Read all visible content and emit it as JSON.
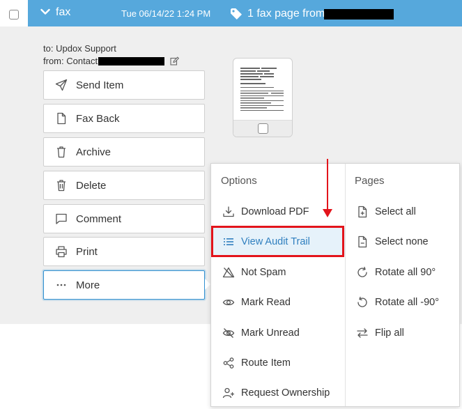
{
  "header": {
    "type_label": "fax",
    "date": "Tue 06/14/22 1:24 PM",
    "subject": "1 fax page from",
    "bar_color": "#56a8dc"
  },
  "meta": {
    "to_label": "to:",
    "to_value": "Updox Support",
    "from_label": "from:",
    "from_value": "Contact"
  },
  "actions": [
    {
      "label": "Send Item",
      "icon": "send-icon"
    },
    {
      "label": "Fax Back",
      "icon": "file-icon"
    },
    {
      "label": "Archive",
      "icon": "archive-icon"
    },
    {
      "label": "Delete",
      "icon": "trash-icon"
    },
    {
      "label": "Comment",
      "icon": "comment-icon"
    },
    {
      "label": "Print",
      "icon": "printer-icon"
    },
    {
      "label": "More",
      "icon": "ellipsis-icon"
    }
  ],
  "menu": {
    "options_heading": "Options",
    "pages_heading": "Pages",
    "options": [
      {
        "label": "Download PDF",
        "icon": "download-icon"
      },
      {
        "label": "View Audit Trail",
        "icon": "list-icon"
      },
      {
        "label": "Not Spam",
        "icon": "no-spam-icon"
      },
      {
        "label": "Mark Read",
        "icon": "eye-icon"
      },
      {
        "label": "Mark Unread",
        "icon": "eye-off-icon"
      },
      {
        "label": "Route Item",
        "icon": "share-icon"
      },
      {
        "label": "Request Ownership",
        "icon": "user-add-icon"
      }
    ],
    "pages": [
      {
        "label": "Select all",
        "icon": "file-plus-icon"
      },
      {
        "label": "Select none",
        "icon": "file-minus-icon"
      },
      {
        "label": "Rotate all 90°",
        "icon": "rotate-cw-icon"
      },
      {
        "label": "Rotate all -90°",
        "icon": "rotate-ccw-icon"
      },
      {
        "label": "Flip all",
        "icon": "flip-icon"
      }
    ]
  },
  "annotation_color": "#e3141b"
}
